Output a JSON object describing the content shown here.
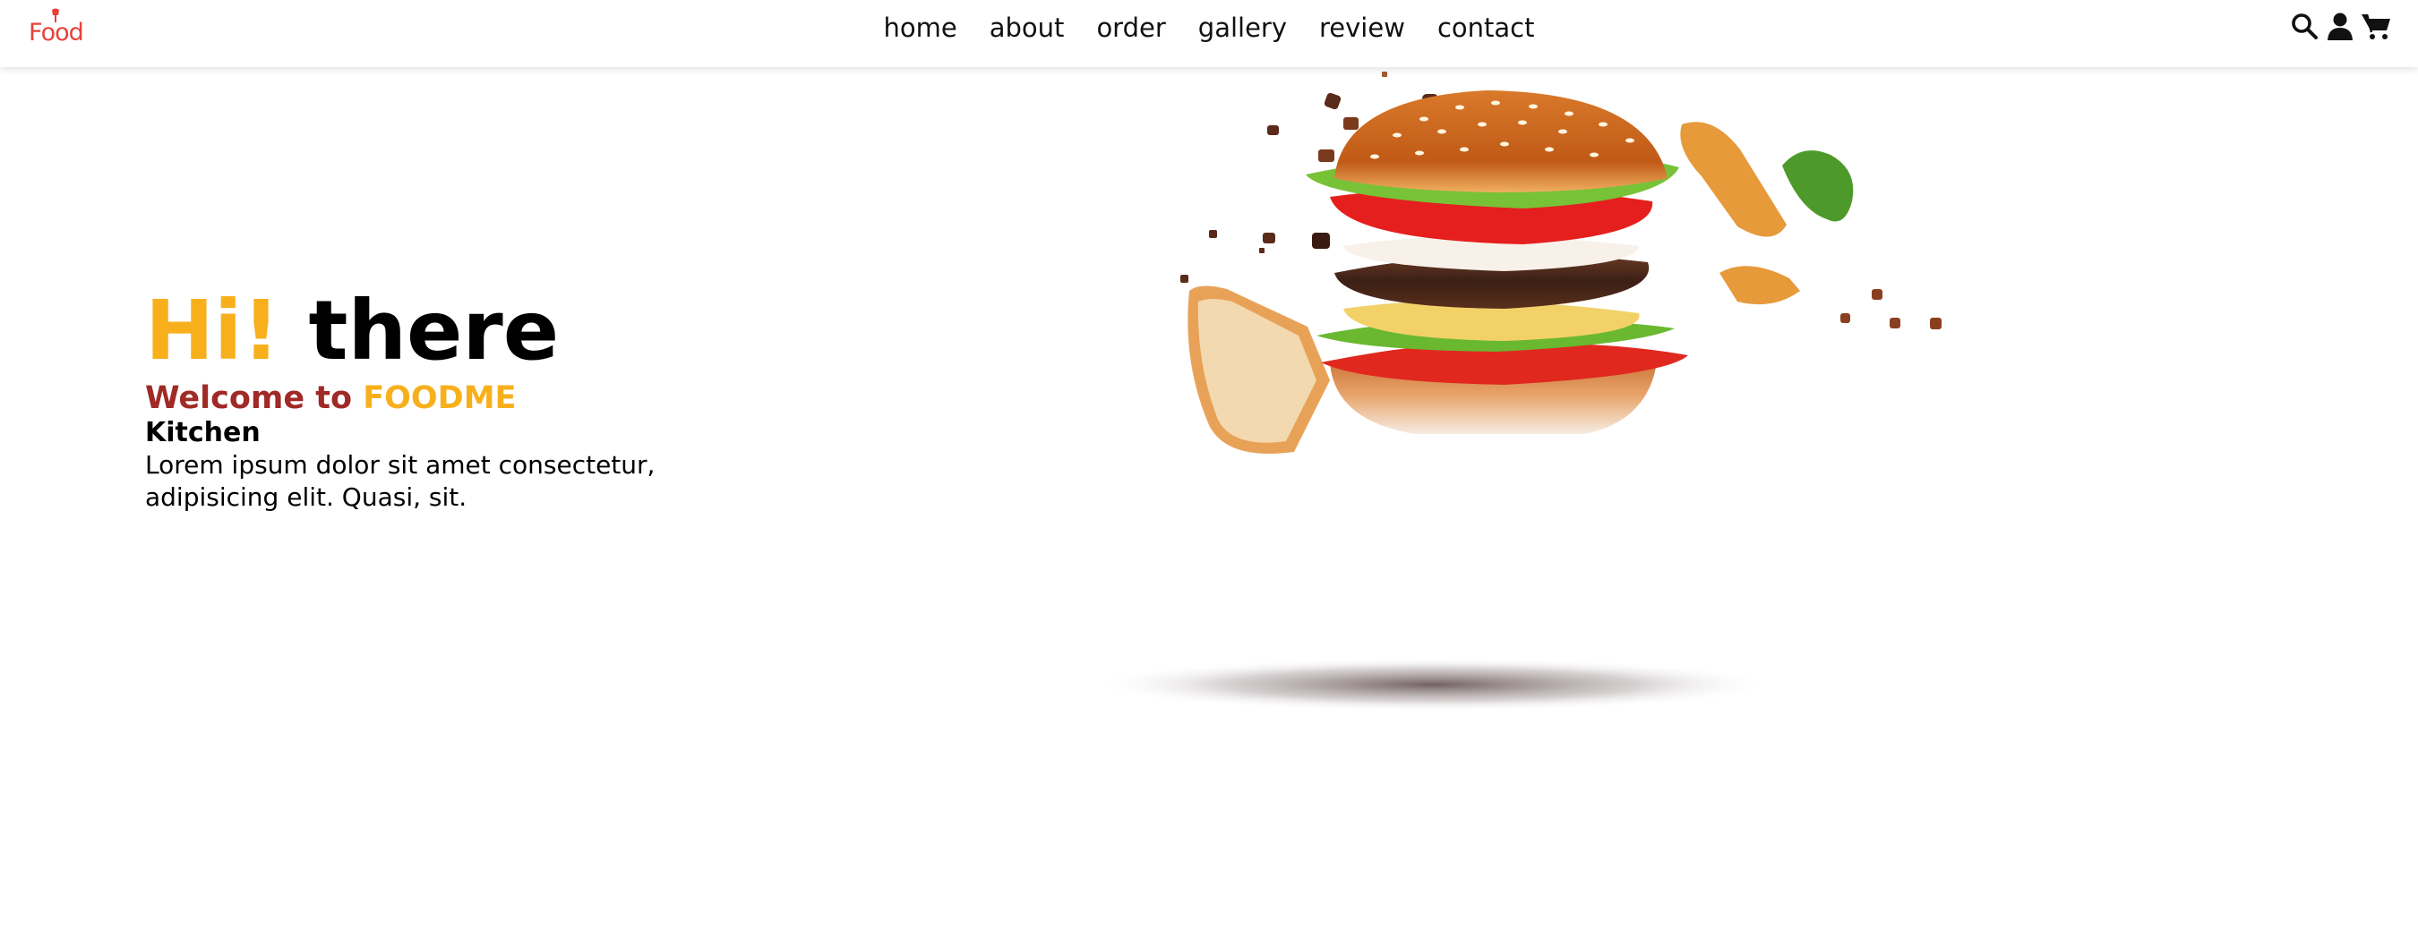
{
  "brand": {
    "logo_text": "Food",
    "logo_icon": "chef-icon"
  },
  "nav": {
    "items": [
      "home",
      "about",
      "order",
      "gallery",
      "review",
      "contact"
    ]
  },
  "header_icons": [
    "search-icon",
    "user-icon",
    "cart-icon"
  ],
  "hero": {
    "title_highlight": "Hi!",
    "title_rest": "there",
    "welcome_prefix": "Welcome to",
    "welcome_brand": "FOODME",
    "kitchen": "Kitchen",
    "description": "Lorem ipsum dolor sit amet consectetur, adipisicing elit. Quasi, sit."
  },
  "colors": {
    "accent": "#f7b01c",
    "brand_red": "#9f2a26",
    "logo_red": "#e8423a"
  }
}
